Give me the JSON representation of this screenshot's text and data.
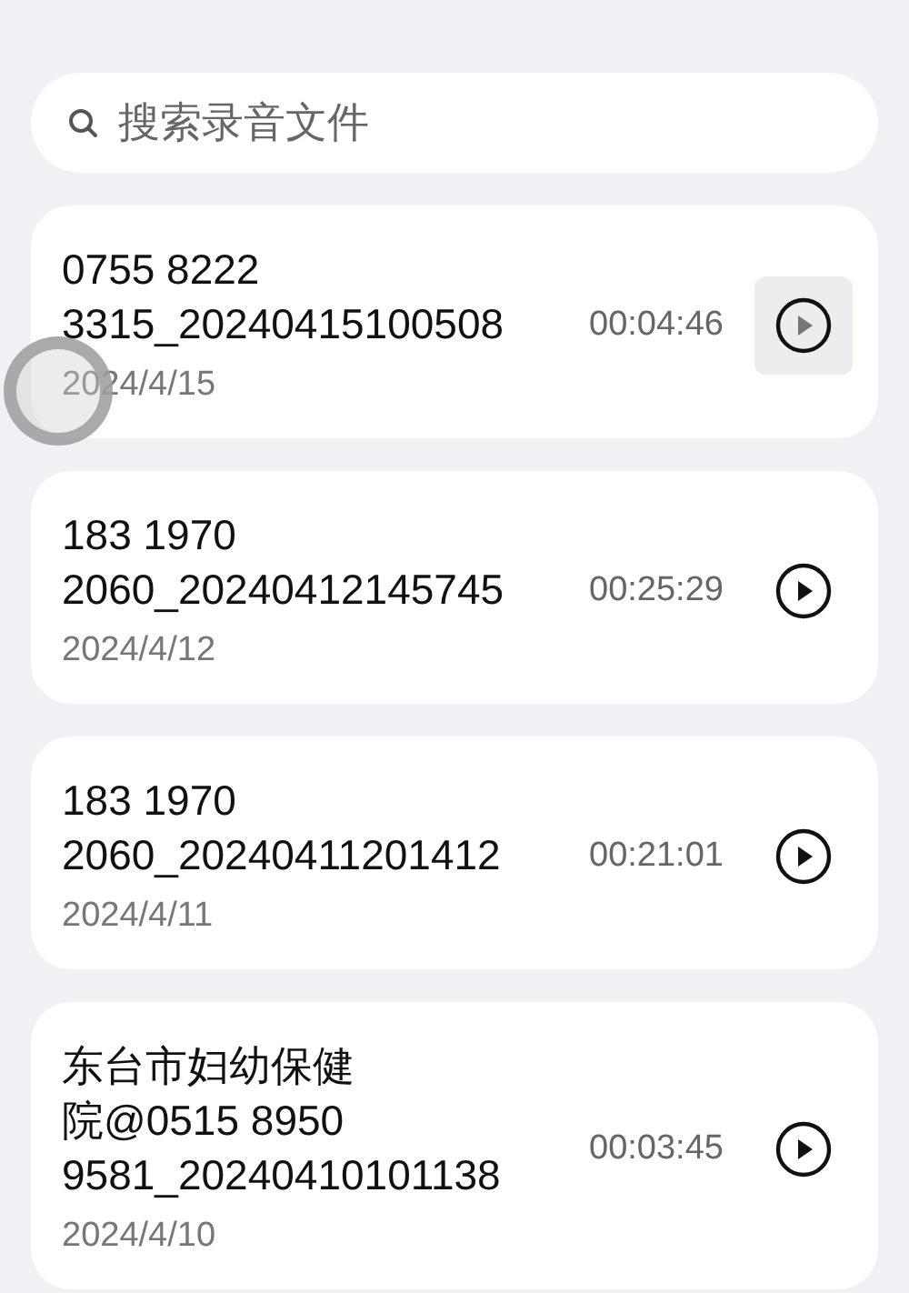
{
  "search": {
    "placeholder": "搜索录音文件"
  },
  "recordings": [
    {
      "title_lines": [
        "0755 8222",
        "3315_20240415100508"
      ],
      "duration": "00:04:46",
      "date": "2024/4/15",
      "pressed": true,
      "touched": true
    },
    {
      "title_lines": [
        "183 1970",
        "2060_20240412145745"
      ],
      "duration": "00:25:29",
      "date": "2024/4/12",
      "pressed": false,
      "touched": false
    },
    {
      "title_lines": [
        "183 1970",
        "2060_20240411201412"
      ],
      "duration": "00:21:01",
      "date": "2024/4/11",
      "pressed": false,
      "touched": false
    },
    {
      "title_lines": [
        "东台市妇幼保健",
        "院@0515 8950",
        "9581_20240410101138"
      ],
      "duration": "00:03:45",
      "date": "2024/4/10",
      "pressed": false,
      "touched": false
    }
  ]
}
